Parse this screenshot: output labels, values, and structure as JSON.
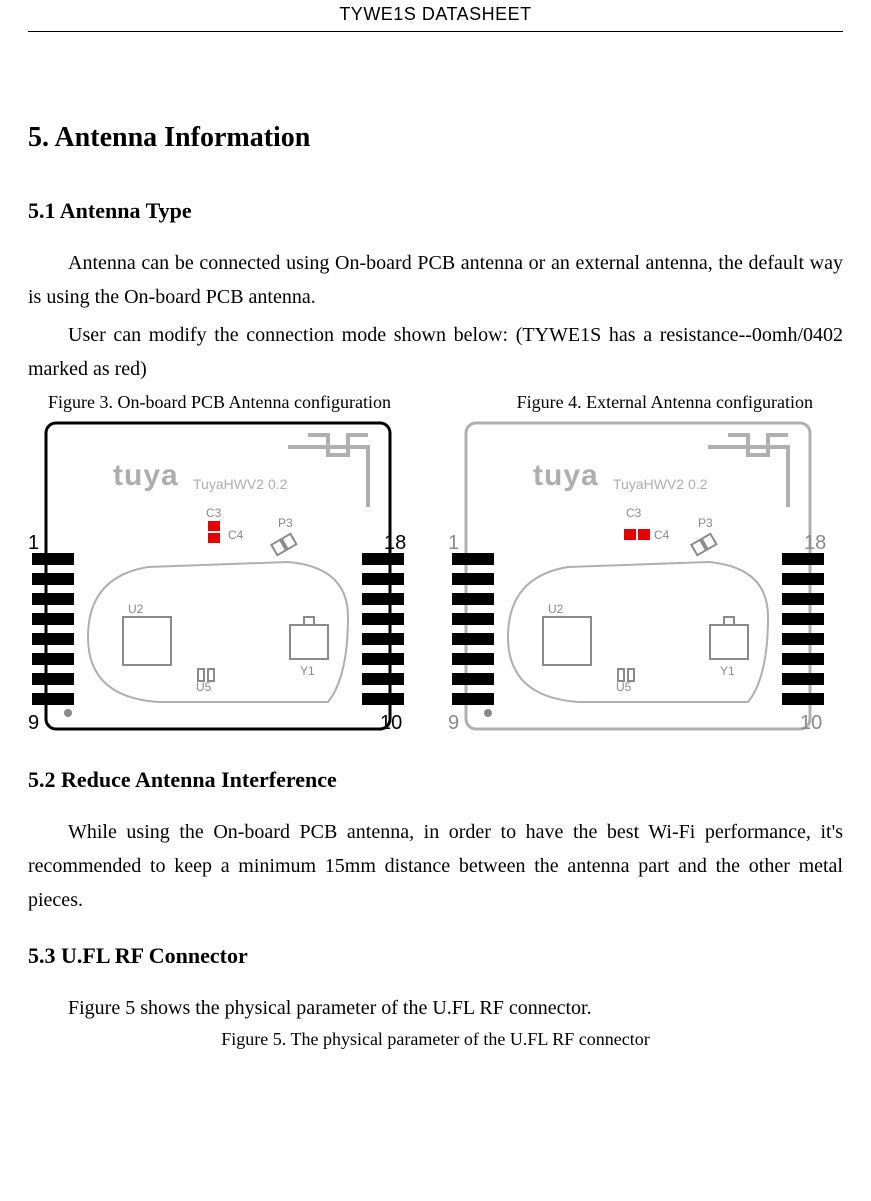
{
  "header": {
    "title": "TYWE1S DATASHEET"
  },
  "section5": {
    "title": "5. Antenna Information",
    "sub1": {
      "title": "5.1 Antenna Type",
      "para1": "Antenna can be connected using On-board PCB antenna or an external antenna, the default way is using the On-board PCB antenna.",
      "para2": "User can modify the connection mode shown below: (TYWE1S has a resistance--0omh/0402 marked as red)",
      "fig3_caption": "Figure 3. On-board PCB Antenna configuration",
      "fig4_caption": "Figure 4. External Antenna configuration"
    },
    "sub2": {
      "title": "5.2 Reduce Antenna Interference",
      "para1": "While using the On-board PCB antenna, in order to have the best Wi-Fi performance, it's recommended to keep a minimum 15mm distance between the antenna part and the other metal pieces."
    },
    "sub3": {
      "title": "5.3 U.FL RF Connector",
      "para1": "Figure 5 shows the physical parameter of the U.FL RF connector.",
      "fig5_caption": "Figure 5. The physical parameter of the U.FL RF connector"
    }
  },
  "board": {
    "logo": "tuya",
    "model": "TuyaHWV2 0.2",
    "labels": {
      "c3": "C3",
      "c4": "C4",
      "p3": "P3",
      "u2": "U2",
      "u5": "U5",
      "y1": "Y1"
    },
    "pins": {
      "top_left": "1",
      "top_right": "18",
      "bottom_left": "9",
      "bottom_right": "10"
    }
  }
}
